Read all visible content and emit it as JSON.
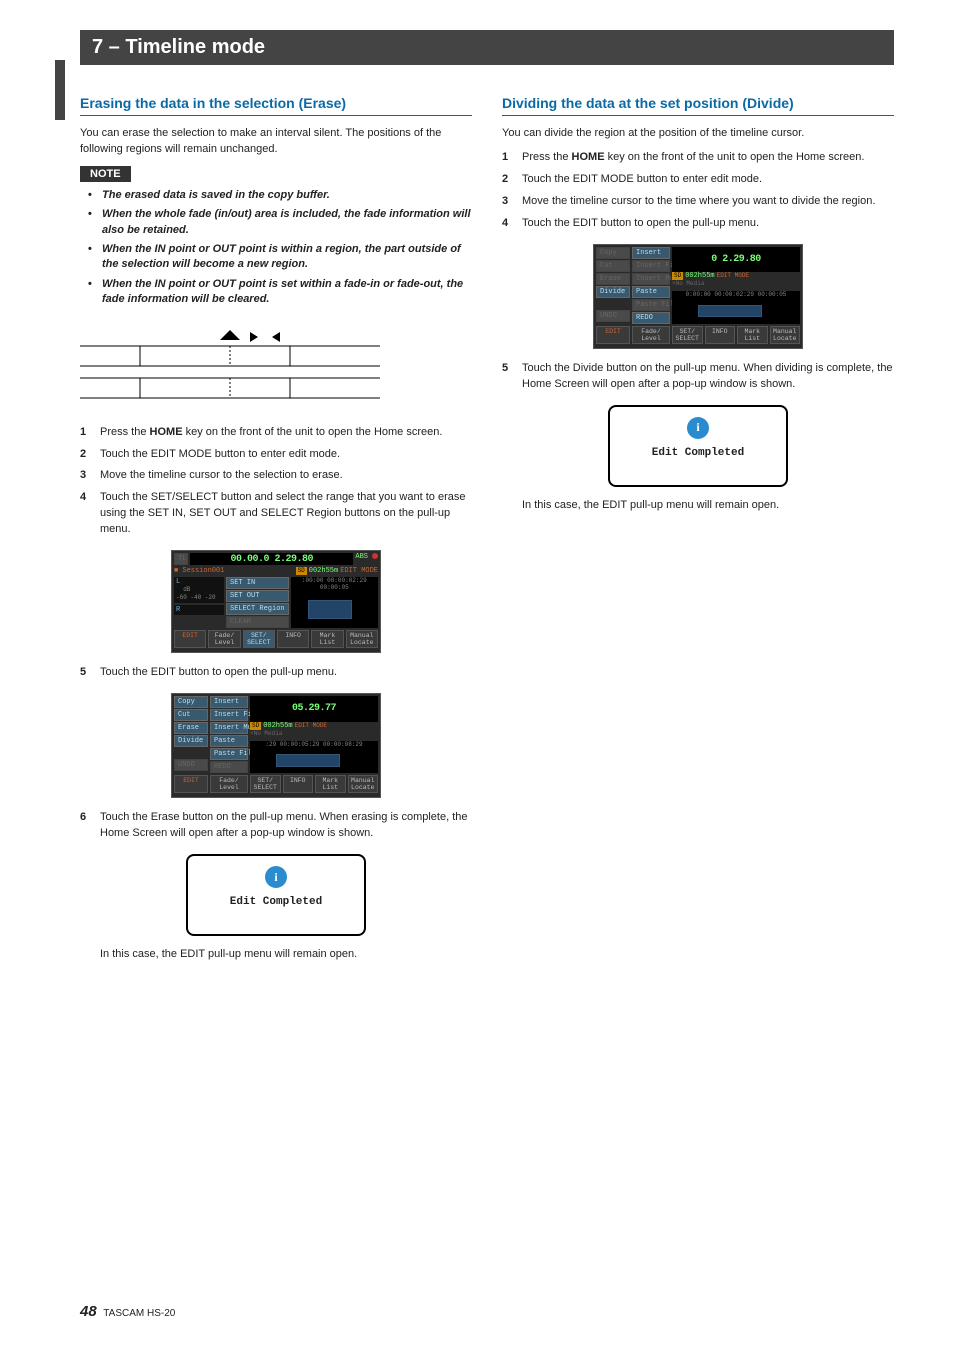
{
  "chapter": "7 – Timeline mode",
  "left": {
    "heading": "Erasing the data in the selection (Erase)",
    "intro": "You can erase the selection to make an interval silent. The positions of the following regions will remain unchanged.",
    "note_label": "NOTE",
    "notes": [
      "The erased data is saved in the copy buffer.",
      "When the whole fade (in/out) area is included, the fade information will also be retained.",
      "When the IN point or OUT point is within a region, the part outside of the selection will become a new region.",
      "When the IN point or OUT point is set within a fade-in or fade-out, the fade information will be cleared."
    ],
    "steps_a": [
      {
        "n": "1",
        "pre": "Press the ",
        "bold": "HOME",
        "post": " key on the front of the unit to open the Home screen."
      },
      {
        "n": "2",
        "pre": "Touch the EDIT MODE button to enter edit mode.",
        "bold": "",
        "post": ""
      },
      {
        "n": "3",
        "pre": "Move the timeline cursor to the selection to erase.",
        "bold": "",
        "post": ""
      },
      {
        "n": "4",
        "pre": "Touch the SET/SELECT button and select the range that you want to erase using the SET IN, SET OUT and SELECT Region buttons on the pull-up menu.",
        "bold": "",
        "post": ""
      }
    ],
    "step5": {
      "n": "5",
      "text": "Touch the EDIT button to open the pull-up menu."
    },
    "step6": {
      "n": "6",
      "text": "Touch the Erase button on the pull-up menu. When erasing is complete, the Home Screen will open after a pop-up window is shown."
    },
    "popup_msg": "Edit Completed",
    "caption": "In this case, the EDIT pull-up menu will remain open."
  },
  "right": {
    "heading": "Dividing the data at the set position (Divide)",
    "intro": "You can divide the region at the position of the timeline cursor.",
    "steps": [
      {
        "n": "1",
        "pre": "Press the ",
        "bold": "HOME",
        "post": " key on the front of the unit to open the Home screen."
      },
      {
        "n": "2",
        "pre": "Touch the EDIT MODE button to enter edit mode.",
        "bold": "",
        "post": ""
      },
      {
        "n": "3",
        "pre": "Move the timeline cursor to the time where you want to divide the region.",
        "bold": "",
        "post": ""
      },
      {
        "n": "4",
        "pre": "Touch the EDIT button to open the pull-up menu.",
        "bold": "",
        "post": ""
      }
    ],
    "step5": {
      "n": "5",
      "text": "Touch the Divide button on the pull-up menu. When dividing is complete, the Home Screen will open after a pop-up window is shown."
    },
    "popup_msg": "Edit Completed",
    "caption": "In this case, the EDIT pull-up menu will remain open."
  },
  "screens": {
    "session": "Session001",
    "card": "SD",
    "remain": "002h55m",
    "mode": "EDIT MODE",
    "nomedia": "No Media",
    "abs": "ABS",
    "s1": {
      "time": "00.00.0 2.29.80",
      "btns": [
        "SET IN",
        "SET OUT",
        "SELECT Region",
        "CLEAR"
      ],
      "bar_times": ":00:00  00:00:02:29  00:00:05",
      "bottom": [
        "EDIT",
        "Fade/ Level",
        "SET/ SELECT",
        "INFO",
        "Mark List",
        "Manual Locate"
      ]
    },
    "s2": {
      "time": "05.29.77",
      "col1": [
        "Copy",
        "Cut",
        "Erase",
        "Divide",
        "",
        "UNDO",
        "EDIT"
      ],
      "col2": [
        "Insert",
        "Insert File",
        "Insert Mute",
        "Paste",
        "Paste File",
        "REDO",
        "Fade/ Level"
      ],
      "bar_times": ":29  00:00:05:29  00:00:08:29",
      "bottom": [
        "SET/ SELECT",
        "INFO",
        "Mark List",
        "Manual Locate"
      ]
    },
    "s3": {
      "time": "0 2.29.80",
      "col1": [
        "Copy",
        "Cut",
        "Erase",
        "Divide",
        "",
        "UNDO",
        "EDIT"
      ],
      "col2": [
        "Insert",
        "Insert File",
        "Insert Mute",
        "Paste",
        "Paste File",
        "REDO",
        "Fade/ Level"
      ],
      "bar_times": "0:00:00  00:00:02:29  00:00:05",
      "bottom": [
        "SET/ SELECT",
        "INFO",
        "Mark List",
        "Manual Locate"
      ]
    }
  },
  "footer": {
    "page": "48",
    "model": "TASCAM HS-20"
  }
}
